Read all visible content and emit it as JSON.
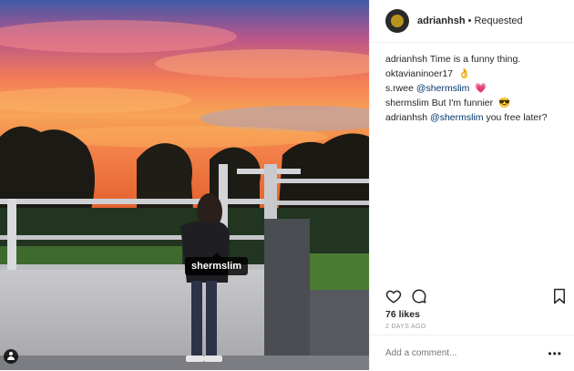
{
  "header": {
    "username": "adrianhsh",
    "separator": "•",
    "follow_status": "Requested"
  },
  "photo": {
    "tag_label": "shermslim"
  },
  "comments": [
    {
      "username": "adrianhsh",
      "text": "Time is a funny thing.",
      "emoji": ""
    },
    {
      "username": "oktavianinoer17",
      "text": "",
      "emoji": "👌"
    },
    {
      "username": "s.rwee",
      "mention": "@shermslim",
      "text": "",
      "emoji": "💗"
    },
    {
      "username": "shermslim",
      "text": "But I'm funnier",
      "emoji": "😎"
    },
    {
      "username": "adrianhsh",
      "mention": "@shermslim",
      "text": "you free later?",
      "emoji": ""
    }
  ],
  "likes": "76 likes",
  "time_ago": "2 DAYS AGO",
  "comment_input": {
    "placeholder": "Add a comment..."
  },
  "more_options": "•••",
  "icons": [
    "heart-icon",
    "comment-icon",
    "bookmark-icon",
    "user-tag-icon",
    "more-options-icon"
  ]
}
